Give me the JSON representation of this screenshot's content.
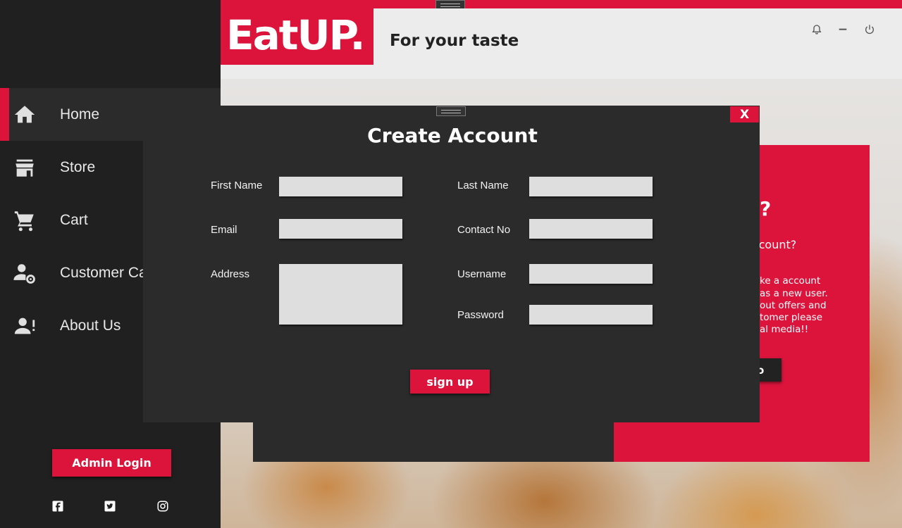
{
  "sidebar": {
    "items": [
      {
        "label": "Home",
        "icon": "home-icon",
        "active": true
      },
      {
        "label": "Store",
        "icon": "store-icon"
      },
      {
        "label": "Cart",
        "icon": "cart-icon"
      },
      {
        "label": "Customer Ca",
        "icon": "customer-settings-icon"
      },
      {
        "label": "About Us",
        "icon": "user-info-icon"
      }
    ],
    "admin_login_label": "Admin Login",
    "social": [
      "facebook-icon",
      "twitter-icon",
      "instagram-icon"
    ]
  },
  "header": {
    "logo": "EatUP.",
    "tagline": "For your taste",
    "window_icons": [
      "bell-icon",
      "minimize-icon",
      "power-icon"
    ]
  },
  "background_card": {
    "heading": "p?",
    "subheading": "account?",
    "body_lines": [
      "ke a account",
      "as a new user.",
      "out offers and",
      "tomer please",
      "al media!!"
    ],
    "button_label": "o"
  },
  "dialog": {
    "title": "Create Account",
    "close_label": "X",
    "fields": {
      "first_name": {
        "label": "First Name",
        "value": ""
      },
      "last_name": {
        "label": "Last Name",
        "value": ""
      },
      "email": {
        "label": "Email",
        "value": ""
      },
      "contact_no": {
        "label": "Contact No",
        "value": ""
      },
      "address": {
        "label": "Address",
        "value": ""
      },
      "username": {
        "label": "Username",
        "value": ""
      },
      "password": {
        "label": "Password",
        "value": ""
      }
    },
    "signup_label": "sign up"
  },
  "colors": {
    "accent": "#dc143c",
    "sidebar_bg": "#202020",
    "dialog_bg": "#2b2b2b",
    "header_bg": "#ececec",
    "input_bg": "#dedede"
  }
}
